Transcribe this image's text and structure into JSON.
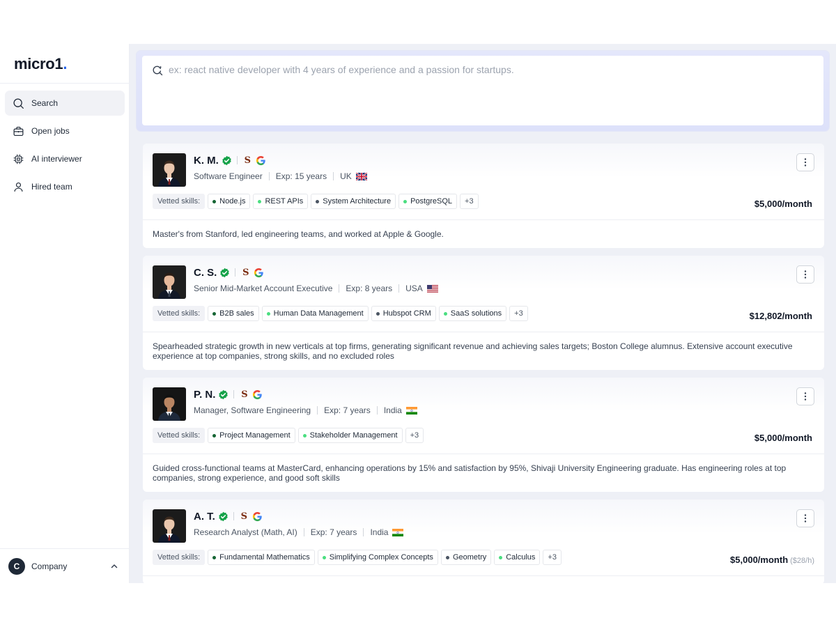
{
  "sidebar": {
    "logo": "micro1",
    "logo_dot": ".",
    "items": [
      {
        "label": "Search",
        "icon": "search-icon"
      },
      {
        "label": "Open jobs",
        "icon": "briefcase-icon"
      },
      {
        "label": "AI interviewer",
        "icon": "chip-icon"
      },
      {
        "label": "Hired team",
        "icon": "user-icon"
      }
    ],
    "company": {
      "initial": "C",
      "label": "Company"
    }
  },
  "search": {
    "placeholder": "ex: react native developer with 4 years of experience and a passion for startups.",
    "value": ""
  },
  "skills_label": "Vetted skills:",
  "colors": {
    "dot_dark": "#166534",
    "dot_light": "#4ade80",
    "verified": "#16a34a",
    "accent": "#2563eb"
  },
  "candidates": [
    {
      "name": "K. M.",
      "role": "Software Engineer",
      "exp": "Exp:  15 years",
      "country": "UK",
      "flag": "uk-flag",
      "skills": [
        {
          "label": "Node.js",
          "dot": "dark"
        },
        {
          "label": "REST APIs",
          "dot": "light"
        },
        {
          "label": "System Architecture",
          "dot": "gray"
        },
        {
          "label": "PostgreSQL",
          "dot": "light"
        }
      ],
      "more": "+3",
      "price": "$5,000/month",
      "price_sub": "",
      "summary": "Master's from Stanford, led engineering teams, and worked at Apple & Google."
    },
    {
      "name": "C. S.",
      "role": "Senior Mid-Market Account Executive",
      "exp": "Exp:  8 years",
      "country": "USA",
      "flag": "us-flag",
      "skills": [
        {
          "label": "B2B sales",
          "dot": "dark"
        },
        {
          "label": "Human Data Management",
          "dot": "light"
        },
        {
          "label": "Hubspot CRM",
          "dot": "gray"
        },
        {
          "label": "SaaS solutions",
          "dot": "light"
        }
      ],
      "more": "+3",
      "price": "$12,802/month",
      "price_sub": "",
      "summary": "Spearheaded strategic growth in new verticals at top firms, generating significant revenue and achieving sales targets; Boston College alumnus. Extensive account executive experience at top companies, strong skills, and no excluded roles"
    },
    {
      "name": "P. N.",
      "role": "Manager, Software Engineering",
      "exp": "Exp:  7 years",
      "country": "India",
      "flag": "india-flag",
      "skills": [
        {
          "label": "Project Management",
          "dot": "dark"
        },
        {
          "label": "Stakeholder Management",
          "dot": "light"
        }
      ],
      "more": "+3",
      "price": "$5,000/month",
      "price_sub": "",
      "summary": "Guided cross-functional teams at MasterCard, enhancing operations by 15% and satisfaction by 95%, Shivaji University Engineering graduate. Has engineering roles at top companies, strong experience, and good soft skills"
    },
    {
      "name": "A. T.",
      "role": "Research Analyst (Math, AI)",
      "exp": "Exp:  7 years",
      "country": "India",
      "flag": "india-flag",
      "skills": [
        {
          "label": "Fundamental Mathematics",
          "dot": "dark"
        },
        {
          "label": "Simplifying Complex Concepts",
          "dot": "light"
        },
        {
          "label": "Geometry",
          "dot": "gray"
        },
        {
          "label": "Calculus",
          "dot": "light"
        }
      ],
      "more": "+3",
      "price": "$5,000/month",
      "price_sub": "($28/h)",
      "summary": ""
    }
  ]
}
